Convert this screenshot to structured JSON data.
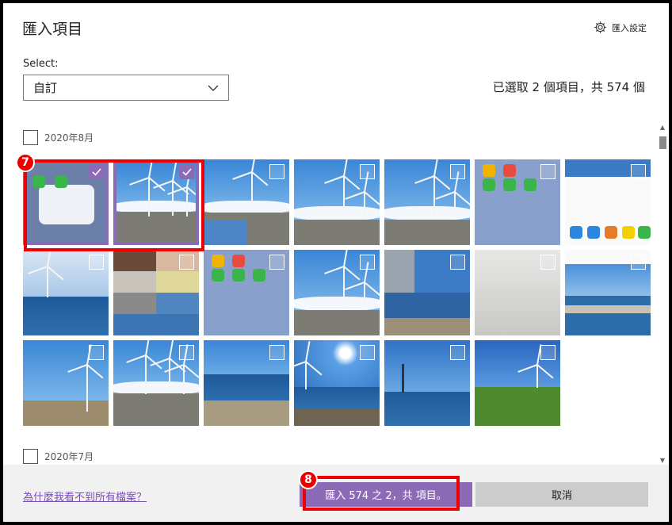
{
  "dialog": {
    "title": "匯入項目",
    "settings_label": "匯入設定",
    "select_label": "Select:",
    "select_value": "自訂",
    "selection_count": "已選取 2 個項目，共 574 個"
  },
  "groups": [
    {
      "label": "2020年8月",
      "checked": false
    },
    {
      "label": "2020年7月",
      "checked": false
    }
  ],
  "tiles": [
    {
      "scene": "phone-code",
      "selected": true
    },
    {
      "scene": "turbines",
      "selected": true
    },
    {
      "scene": "turbines-collage",
      "selected": false
    },
    {
      "scene": "turbine-single",
      "selected": false
    },
    {
      "scene": "turbine-single",
      "selected": false
    },
    {
      "scene": "phone-home",
      "selected": false
    },
    {
      "scene": "sea-screenshot",
      "selected": false
    },
    {
      "scene": "sea-horizon",
      "selected": false
    },
    {
      "scene": "photo-collage",
      "selected": false
    },
    {
      "scene": "phone-home",
      "selected": false
    },
    {
      "scene": "turbine-single",
      "selected": false
    },
    {
      "scene": "sea-collage",
      "selected": false
    },
    {
      "scene": "gray",
      "selected": false
    },
    {
      "scene": "pool",
      "selected": false
    },
    {
      "scene": "turbine-beach",
      "selected": false
    },
    {
      "scene": "turbines",
      "selected": false
    },
    {
      "scene": "beach",
      "selected": false
    },
    {
      "scene": "sunny-beach",
      "selected": false
    },
    {
      "scene": "sea-tower",
      "selected": false
    },
    {
      "scene": "grass",
      "selected": false
    }
  ],
  "footer": {
    "help_link": "為什麼我看不到所有檔案？",
    "import_button": "匯入 574 之 2，共 項目。",
    "cancel_button": "取消"
  },
  "annotations": {
    "badge1": "7",
    "badge2": "8"
  },
  "colors": {
    "accent": "#8b6bb5",
    "highlight": "#ee0000"
  }
}
